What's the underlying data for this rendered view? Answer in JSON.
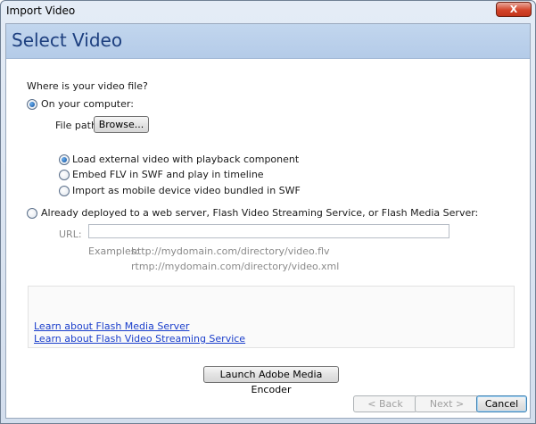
{
  "window": {
    "title": "Import Video",
    "close_label": "X"
  },
  "header": {
    "title": "Select Video"
  },
  "question": "Where is your video file?",
  "computer": {
    "label": "On your computer:",
    "file_path_label": "File path:",
    "browse_label": "Browse..."
  },
  "options": [
    {
      "label": "Load external video with playback component",
      "checked": true
    },
    {
      "label": "Embed FLV in SWF and play in timeline",
      "checked": false
    },
    {
      "label": "Import as mobile device video bundled in SWF",
      "checked": false
    }
  ],
  "deployed": {
    "label": "Already deployed to a web server, Flash Video Streaming Service, or Flash Media Server:",
    "url_label": "URL:",
    "url_value": "",
    "examples_label": "Examples:",
    "example1": "http://mydomain.com/directory/video.flv",
    "example2": "rtmp://mydomain.com/directory/video.xml"
  },
  "links": {
    "media_server": "Learn about Flash Media Server",
    "streaming_service": "Learn about Flash Video Streaming Service"
  },
  "launch_encoder_label": "Launch Adobe Media Encoder",
  "nav": {
    "back": "< Back",
    "next": "Next >",
    "cancel": "Cancel"
  }
}
